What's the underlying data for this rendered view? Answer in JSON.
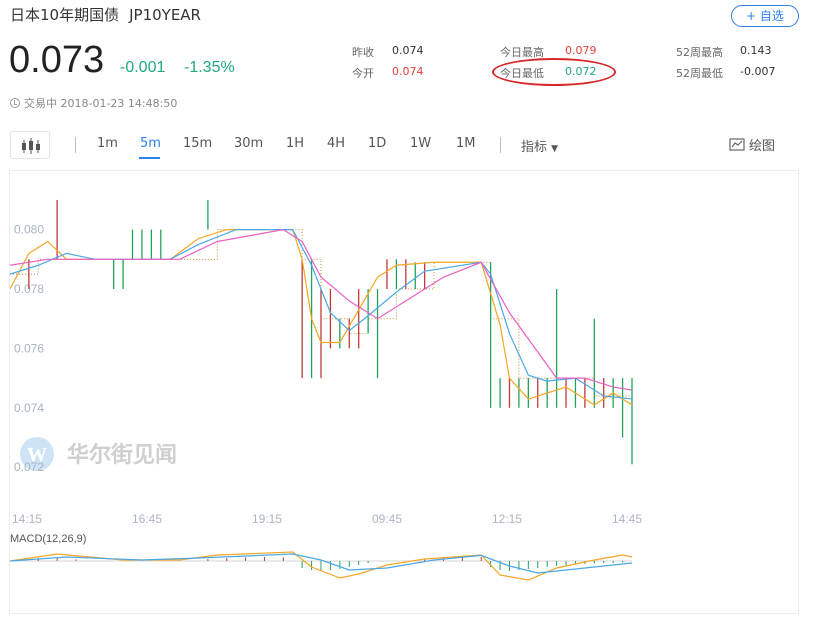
{
  "header": {
    "name": "日本10年期国债",
    "code": "JP10YEAR",
    "add_label": "+ 自选"
  },
  "quote": {
    "price": "0.073",
    "change": "-0.001",
    "change_pct": "-1.35%",
    "status": "交易中 2018-01-23 14:48:50"
  },
  "stats": {
    "prev_close_label": "昨收",
    "prev_close": "0.074",
    "open_label": "今开",
    "open": "0.074",
    "day_high_label": "今日最高",
    "day_high": "0.079",
    "day_low_label": "今日最低",
    "day_low": "0.072",
    "w52_high_label": "52周最高",
    "w52_high": "0.143",
    "w52_low_label": "52周最低",
    "w52_low": "-0.007"
  },
  "toolbar": {
    "timeframes": [
      "1m",
      "5m",
      "15m",
      "30m",
      "1H",
      "4H",
      "1D",
      "1W",
      "1M"
    ],
    "active": "5m",
    "indicator_label": "指标",
    "draw_label": "绘图"
  },
  "watermark": "华尔街见闻",
  "colors": {
    "up": "#e0423d",
    "down": "#20a87e",
    "accent": "#2f80ed",
    "ma_fast": "#f5a623",
    "ma_mid": "#4aa8e8",
    "ma_slow": "#ec5fc6"
  },
  "chart_data": {
    "type": "candlestick",
    "y_ticks": [
      "0.080",
      "0.078",
      "0.076",
      "0.074",
      "0.072"
    ],
    "x_ticks": [
      "14:15",
      "16:45",
      "19:15",
      "09:45",
      "12:15",
      "14:45"
    ],
    "ylim": [
      0.0712,
      0.0813
    ],
    "macd_label": "MACD(12,26,9)",
    "price_steps": [
      [
        0,
        0.0785
      ],
      [
        3,
        0.079
      ],
      [
        6,
        0.079
      ],
      [
        9,
        0.079
      ],
      [
        12,
        0.079
      ],
      [
        17,
        0.079
      ],
      [
        22,
        0.08
      ],
      [
        30,
        0.08
      ],
      [
        31,
        0.079
      ],
      [
        33,
        0.077
      ],
      [
        36,
        0.0765
      ],
      [
        38,
        0.077
      ],
      [
        41,
        0.078
      ],
      [
        45,
        0.0789
      ],
      [
        50,
        0.0789
      ],
      [
        51,
        0.077
      ],
      [
        54,
        0.075
      ],
      [
        59,
        0.075
      ],
      [
        62,
        0.0744
      ],
      [
        66,
        0.0744
      ]
    ],
    "ticks_vertical": [
      [
        2,
        0.079,
        0.078,
        "r"
      ],
      [
        5,
        0.081,
        0.079,
        "r"
      ],
      [
        11,
        0.079,
        0.078,
        "g"
      ],
      [
        12,
        0.079,
        0.078,
        "g"
      ],
      [
        13,
        0.08,
        0.079,
        "g"
      ],
      [
        14,
        0.08,
        0.079,
        "g"
      ],
      [
        15,
        0.08,
        0.079,
        "g"
      ],
      [
        16,
        0.08,
        0.079,
        "g"
      ],
      [
        21,
        0.081,
        0.08,
        "g"
      ],
      [
        31,
        0.079,
        0.075,
        "r"
      ],
      [
        32,
        0.079,
        0.075,
        "g"
      ],
      [
        33,
        0.078,
        0.075,
        "r"
      ],
      [
        34,
        0.078,
        0.076,
        "r"
      ],
      [
        35,
        0.077,
        0.076,
        "g"
      ],
      [
        36,
        0.077,
        0.076,
        "r"
      ],
      [
        37,
        0.078,
        0.076,
        "r"
      ],
      [
        38,
        0.078,
        0.0765,
        "g"
      ],
      [
        39,
        0.078,
        0.075,
        "g"
      ],
      [
        40,
        0.079,
        0.078,
        "r"
      ],
      [
        41,
        0.079,
        0.078,
        "g"
      ],
      [
        42,
        0.079,
        0.078,
        "r"
      ],
      [
        43,
        0.0789,
        0.078,
        "g"
      ],
      [
        44,
        0.0789,
        0.078,
        "r"
      ],
      [
        51,
        0.0789,
        0.074,
        "g"
      ],
      [
        52,
        0.075,
        0.074,
        "g"
      ],
      [
        53,
        0.075,
        0.074,
        "r"
      ],
      [
        54,
        0.075,
        0.074,
        "g"
      ],
      [
        55,
        0.075,
        0.074,
        "g"
      ],
      [
        56,
        0.075,
        0.074,
        "r"
      ],
      [
        57,
        0.075,
        0.074,
        "g"
      ],
      [
        58,
        0.078,
        0.074,
        "g"
      ],
      [
        59,
        0.075,
        0.074,
        "r"
      ],
      [
        60,
        0.075,
        0.074,
        "g"
      ],
      [
        61,
        0.075,
        0.074,
        "r"
      ],
      [
        62,
        0.077,
        0.074,
        "g"
      ],
      [
        63,
        0.075,
        0.074,
        "r"
      ],
      [
        64,
        0.075,
        0.074,
        "g"
      ],
      [
        65,
        0.075,
        0.073,
        "g"
      ],
      [
        66,
        0.075,
        0.0721,
        "g"
      ]
    ],
    "ma_fast": [
      [
        0,
        0.078
      ],
      [
        2,
        0.0792
      ],
      [
        4,
        0.0796
      ],
      [
        6,
        0.079
      ],
      [
        12,
        0.079
      ],
      [
        17,
        0.079
      ],
      [
        20,
        0.0797
      ],
      [
        23,
        0.08
      ],
      [
        30,
        0.08
      ],
      [
        31,
        0.079
      ],
      [
        32,
        0.077
      ],
      [
        33,
        0.0762
      ],
      [
        35,
        0.0762
      ],
      [
        37,
        0.0773
      ],
      [
        39,
        0.0784
      ],
      [
        41,
        0.0788
      ],
      [
        45,
        0.0789
      ],
      [
        50,
        0.0789
      ],
      [
        52,
        0.0768
      ],
      [
        53,
        0.075
      ],
      [
        55,
        0.0743
      ],
      [
        59,
        0.0747
      ],
      [
        62,
        0.0741
      ],
      [
        64,
        0.0745
      ],
      [
        66,
        0.0741
      ]
    ],
    "ma_mid": [
      [
        0,
        0.0785
      ],
      [
        3,
        0.0788
      ],
      [
        6,
        0.0792
      ],
      [
        9,
        0.079
      ],
      [
        17,
        0.079
      ],
      [
        20,
        0.0795
      ],
      [
        24,
        0.08
      ],
      [
        30,
        0.08
      ],
      [
        32,
        0.0788
      ],
      [
        34,
        0.0772
      ],
      [
        36,
        0.0766
      ],
      [
        38,
        0.0771
      ],
      [
        41,
        0.0779
      ],
      [
        44,
        0.0786
      ],
      [
        50,
        0.0789
      ],
      [
        51,
        0.0785
      ],
      [
        53,
        0.0765
      ],
      [
        55,
        0.0751
      ],
      [
        57,
        0.0749
      ],
      [
        60,
        0.075
      ],
      [
        63,
        0.0744
      ],
      [
        66,
        0.0743
      ]
    ],
    "ma_slow": [
      [
        0,
        0.0788
      ],
      [
        4,
        0.079
      ],
      [
        9,
        0.079
      ],
      [
        18,
        0.079
      ],
      [
        22,
        0.0796
      ],
      [
        29,
        0.08
      ],
      [
        31,
        0.0796
      ],
      [
        33,
        0.0784
      ],
      [
        36,
        0.0776
      ],
      [
        39,
        0.077
      ],
      [
        42,
        0.0776
      ],
      [
        46,
        0.0784
      ],
      [
        50,
        0.0789
      ],
      [
        53,
        0.0772
      ],
      [
        58,
        0.075
      ],
      [
        61,
        0.075
      ],
      [
        64,
        0.0747
      ],
      [
        66,
        0.0746
      ]
    ],
    "macd_dif": [
      [
        0,
        0
      ],
      [
        5,
        0.35
      ],
      [
        12,
        0.05
      ],
      [
        18,
        0.05
      ],
      [
        22,
        0.3
      ],
      [
        30,
        0.45
      ],
      [
        32,
        -0.3
      ],
      [
        35,
        -0.85
      ],
      [
        37,
        -0.65
      ],
      [
        40,
        -0.2
      ],
      [
        44,
        0.1
      ],
      [
        50,
        0.3
      ],
      [
        52,
        -0.7
      ],
      [
        55,
        -0.95
      ],
      [
        58,
        -0.35
      ],
      [
        62,
        0.05
      ],
      [
        65,
        0.3
      ],
      [
        66,
        0.2
      ]
    ],
    "macd_dea": [
      [
        0,
        0
      ],
      [
        6,
        0.2
      ],
      [
        14,
        0.05
      ],
      [
        20,
        0.15
      ],
      [
        30,
        0.35
      ],
      [
        33,
        0.05
      ],
      [
        36,
        -0.45
      ],
      [
        40,
        -0.35
      ],
      [
        45,
        0.05
      ],
      [
        50,
        0.28
      ],
      [
        53,
        -0.25
      ],
      [
        56,
        -0.6
      ],
      [
        60,
        -0.4
      ],
      [
        66,
        -0.1
      ]
    ],
    "macd_hist": [
      [
        1,
        0.1
      ],
      [
        3,
        0.15
      ],
      [
        5,
        0.18
      ],
      [
        7,
        0.08
      ],
      [
        21,
        0.1
      ],
      [
        23,
        0.15
      ],
      [
        25,
        0.18
      ],
      [
        27,
        0.2
      ],
      [
        29,
        0.18
      ],
      [
        31,
        -0.35
      ],
      [
        32,
        -0.45
      ],
      [
        33,
        -0.5
      ],
      [
        34,
        -0.45
      ],
      [
        35,
        -0.4
      ],
      [
        36,
        -0.3
      ],
      [
        37,
        -0.2
      ],
      [
        38,
        -0.1
      ],
      [
        44,
        0.12
      ],
      [
        46,
        0.18
      ],
      [
        48,
        0.22
      ],
      [
        50,
        0.2
      ],
      [
        51,
        -0.3
      ],
      [
        52,
        -0.45
      ],
      [
        53,
        -0.5
      ],
      [
        54,
        -0.45
      ],
      [
        55,
        -0.4
      ],
      [
        56,
        -0.35
      ],
      [
        57,
        -0.3
      ],
      [
        58,
        -0.25
      ],
      [
        59,
        -0.22
      ],
      [
        60,
        -0.18
      ],
      [
        61,
        -0.15
      ],
      [
        62,
        -0.12
      ],
      [
        63,
        -0.1
      ],
      [
        64,
        -0.1
      ],
      [
        65,
        -0.08
      ]
    ]
  }
}
